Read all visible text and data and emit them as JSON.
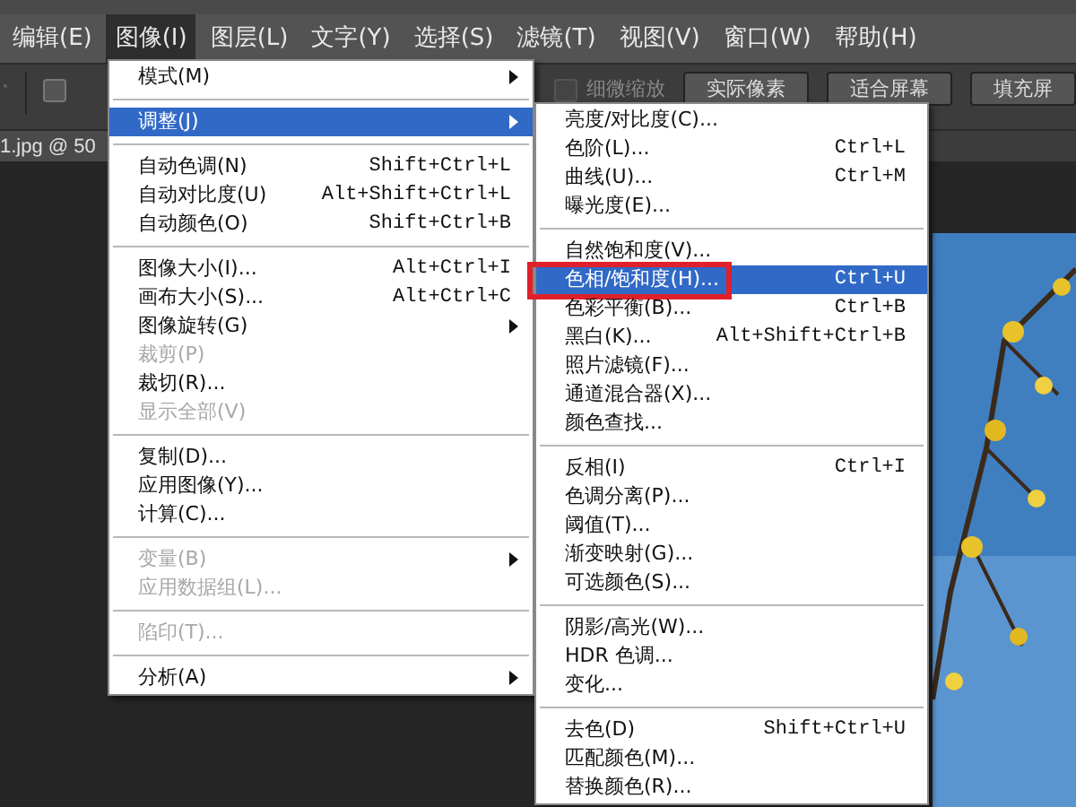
{
  "menubar": [
    {
      "label": "编辑(E)",
      "selected": false
    },
    {
      "label": "图像(I)",
      "selected": true
    },
    {
      "label": "图层(L)",
      "selected": false
    },
    {
      "label": "文字(Y)",
      "selected": false
    },
    {
      "label": "选择(S)",
      "selected": false
    },
    {
      "label": "滤镜(T)",
      "selected": false
    },
    {
      "label": "视图(V)",
      "selected": false
    },
    {
      "label": "窗口(W)",
      "selected": false
    },
    {
      "label": "帮助(H)",
      "selected": false
    }
  ],
  "toolbar": {
    "resize_windows": {
      "checked": false
    },
    "fine_zoom": {
      "label": "细微缩放",
      "disabled": true
    },
    "buttons": [
      "实际像素",
      "适合屏幕",
      "填充屏"
    ]
  },
  "document_tab": {
    "title": "1.jpg @ 50"
  },
  "image_menu": {
    "groups": [
      [
        {
          "label": "模式(M)",
          "submenu": true,
          "selected": false,
          "disabled": false
        }
      ],
      [
        {
          "label": "调整(J)",
          "submenu": true,
          "selected": true,
          "disabled": false
        }
      ],
      [
        {
          "label": "自动色调(N)",
          "shortcut": "Shift+Ctrl+L",
          "selected": false,
          "disabled": false
        },
        {
          "label": "自动对比度(U)",
          "shortcut": "Alt+Shift+Ctrl+L",
          "selected": false,
          "disabled": false
        },
        {
          "label": "自动颜色(O)",
          "shortcut": "Shift+Ctrl+B",
          "selected": false,
          "disabled": false
        }
      ],
      [
        {
          "label": "图像大小(I)...",
          "shortcut": "Alt+Ctrl+I",
          "selected": false,
          "disabled": false
        },
        {
          "label": "画布大小(S)...",
          "shortcut": "Alt+Ctrl+C",
          "selected": false,
          "disabled": false
        },
        {
          "label": "图像旋转(G)",
          "submenu": true,
          "selected": false,
          "disabled": false
        },
        {
          "label": "裁剪(P)",
          "selected": false,
          "disabled": true
        },
        {
          "label": "裁切(R)...",
          "selected": false,
          "disabled": false
        },
        {
          "label": "显示全部(V)",
          "selected": false,
          "disabled": true
        }
      ],
      [
        {
          "label": "复制(D)...",
          "selected": false,
          "disabled": false
        },
        {
          "label": "应用图像(Y)...",
          "selected": false,
          "disabled": false
        },
        {
          "label": "计算(C)...",
          "selected": false,
          "disabled": false
        }
      ],
      [
        {
          "label": "变量(B)",
          "submenu": true,
          "selected": false,
          "disabled": true
        },
        {
          "label": "应用数据组(L)...",
          "selected": false,
          "disabled": true
        }
      ],
      [
        {
          "label": "陷印(T)...",
          "selected": false,
          "disabled": true
        }
      ],
      [
        {
          "label": "分析(A)",
          "submenu": true,
          "selected": false,
          "disabled": false
        }
      ]
    ]
  },
  "adjust_menu": {
    "groups": [
      [
        {
          "label": "亮度/对比度(C)...",
          "selected": false,
          "highlighted": false
        },
        {
          "label": "色阶(L)...",
          "shortcut": "Ctrl+L",
          "selected": false,
          "highlighted": false
        },
        {
          "label": "曲线(U)...",
          "shortcut": "Ctrl+M",
          "selected": false,
          "highlighted": false
        },
        {
          "label": "曝光度(E)...",
          "selected": false,
          "highlighted": false
        }
      ],
      [
        {
          "label": "自然饱和度(V)...",
          "selected": false,
          "highlighted": false
        },
        {
          "label": "色相/饱和度(H)...",
          "shortcut": "Ctrl+U",
          "selected": true,
          "highlighted": true
        },
        {
          "label": "色彩平衡(B)...",
          "shortcut": "Ctrl+B",
          "selected": false,
          "highlighted": false
        },
        {
          "label": "黑白(K)...",
          "shortcut": "Alt+Shift+Ctrl+B",
          "selected": false,
          "highlighted": false
        },
        {
          "label": "照片滤镜(F)...",
          "selected": false,
          "highlighted": false
        },
        {
          "label": "通道混合器(X)...",
          "selected": false,
          "highlighted": false
        },
        {
          "label": "颜色查找...",
          "selected": false,
          "highlighted": false
        }
      ],
      [
        {
          "label": "反相(I)",
          "shortcut": "Ctrl+I",
          "selected": false,
          "highlighted": false
        },
        {
          "label": "色调分离(P)...",
          "selected": false,
          "highlighted": false
        },
        {
          "label": "阈值(T)...",
          "selected": false,
          "highlighted": false
        },
        {
          "label": "渐变映射(G)...",
          "selected": false,
          "highlighted": false
        },
        {
          "label": "可选颜色(S)...",
          "selected": false,
          "highlighted": false
        }
      ],
      [
        {
          "label": "阴影/高光(W)...",
          "selected": false,
          "highlighted": false
        },
        {
          "label": "HDR 色调...",
          "selected": false,
          "highlighted": false
        },
        {
          "label": "变化...",
          "selected": false,
          "highlighted": false
        }
      ],
      [
        {
          "label": "去色(D)",
          "shortcut": "Shift+Ctrl+U",
          "selected": false,
          "highlighted": false
        },
        {
          "label": "匹配颜色(M)...",
          "selected": false,
          "highlighted": false
        },
        {
          "label": "替换颜色(R)...",
          "selected": false,
          "highlighted": false
        }
      ]
    ]
  }
}
